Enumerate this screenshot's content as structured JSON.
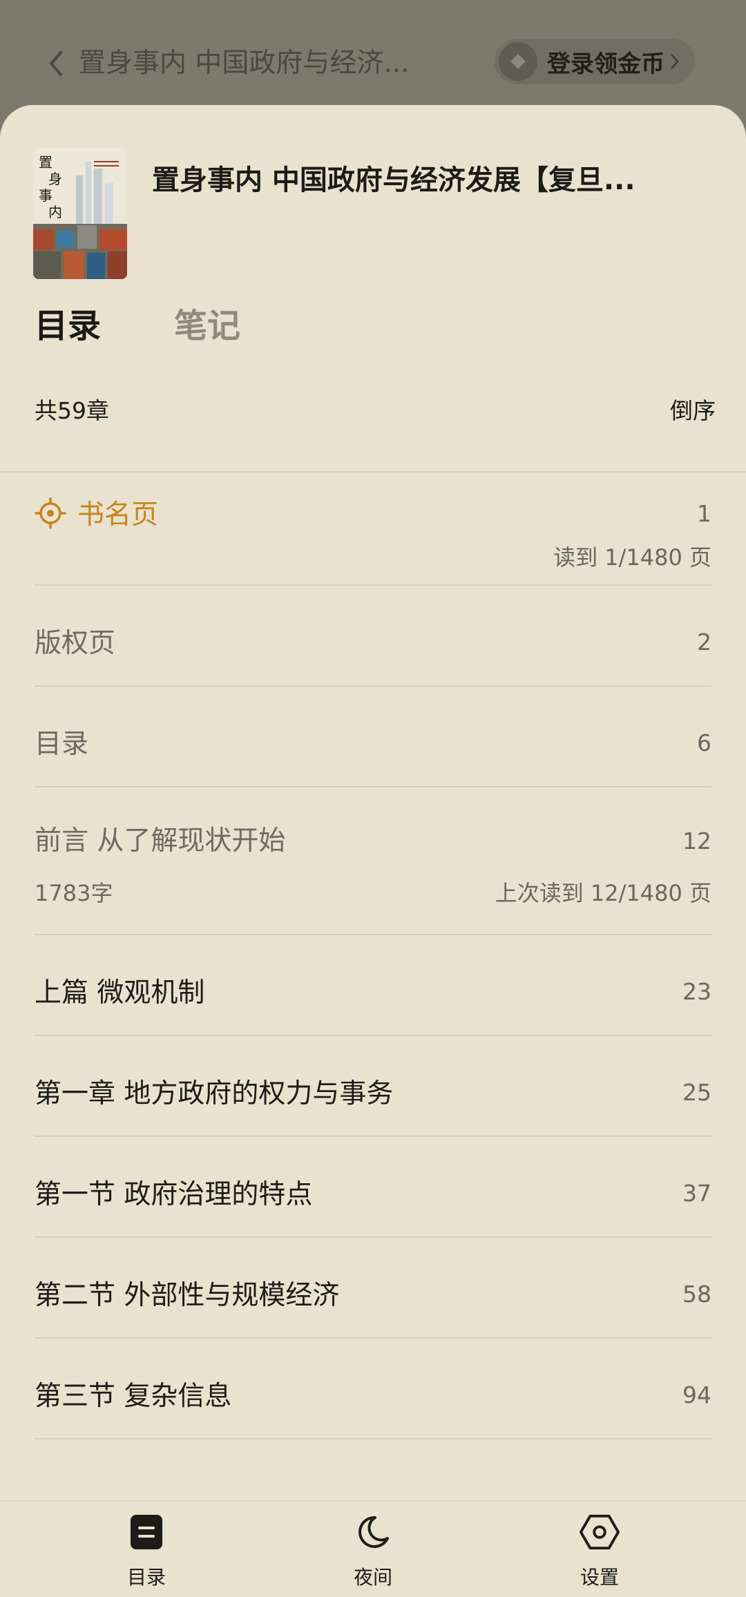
{
  "header": {
    "title": "置身事内 中国政府与经济...",
    "coin_label": "登录领金币"
  },
  "book": {
    "title": "置身事内 中国政府与经济发展【复旦...",
    "cover_title": "置身事内"
  },
  "tabs": [
    {
      "label": "目录",
      "active": true
    },
    {
      "label": "笔记",
      "active": false
    }
  ],
  "toc": {
    "count_label": "共59章",
    "sort_label": "倒序",
    "items": [
      {
        "title": "书名页",
        "page": "1",
        "sub_right": "读到 1/1480 页",
        "state": "current"
      },
      {
        "title": "版权页",
        "page": "2",
        "state": "read"
      },
      {
        "title": "目录",
        "page": "6",
        "state": "read"
      },
      {
        "title": "前言 从了解现状开始",
        "page": "12",
        "sub_left": "1783字",
        "sub_right": "上次读到 12/1480 页",
        "state": "read"
      },
      {
        "title": "上篇 微观机制",
        "page": "23",
        "state": "unread"
      },
      {
        "title": "第一章 地方政府的权力与事务",
        "page": "25",
        "state": "unread"
      },
      {
        "title": "第一节 政府治理的特点",
        "page": "37",
        "state": "unread"
      },
      {
        "title": "第二节 外部性与规模经济",
        "page": "58",
        "state": "unread"
      },
      {
        "title": "第三节 复杂信息",
        "page": "94",
        "state": "unread"
      }
    ]
  },
  "bottom_nav": [
    {
      "label": "目录",
      "icon": "toc-icon"
    },
    {
      "label": "夜间",
      "icon": "moon-icon"
    },
    {
      "label": "设置",
      "icon": "settings-hexagon-icon"
    }
  ],
  "colors": {
    "sheet_bg": "#e8e2cf",
    "accent": "#c7841b",
    "divider": "#d3cdba"
  }
}
